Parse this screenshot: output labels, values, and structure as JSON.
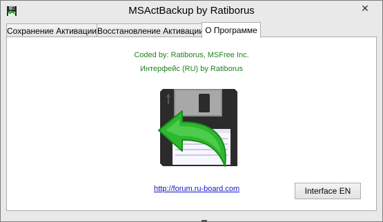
{
  "window": {
    "title": "MSActBackup by Ratiborus",
    "app_icon": "floppy-disk-icon",
    "close_glyph": "✕"
  },
  "tabs": [
    {
      "label": "Сохранение Активации",
      "active": false
    },
    {
      "label": "Восстановление Активации",
      "active": false
    },
    {
      "label": "О Программе",
      "active": true
    }
  ],
  "about": {
    "credit_line1": "Coded by: Ratiborus, MSFree Inc.",
    "credit_line2": "Интерфейс (RU) by Ratiborus",
    "image_icon": "floppy-restore-icon",
    "link": "http://forum.ru-board.com",
    "interface_button": "Interface EN"
  },
  "colors": {
    "credit_text": "#1f7f1f",
    "link": "#1515c8",
    "arrow_green": "#2db82d"
  }
}
